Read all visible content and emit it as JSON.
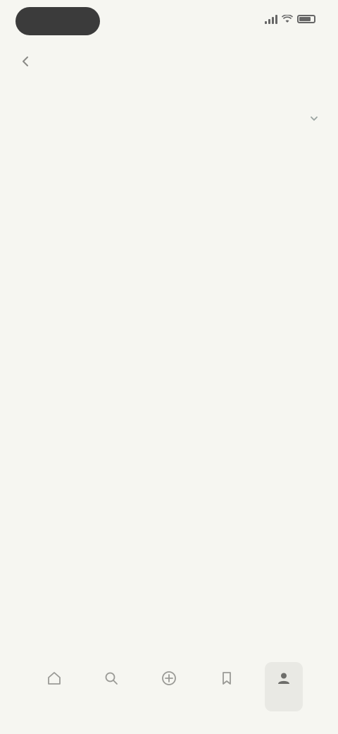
{
  "status_bar": {
    "time": "",
    "icons": [
      "signal-icon",
      "wifi-icon",
      "battery-icon"
    ]
  },
  "header": {
    "title": "",
    "back_icon": "back-arrow-icon"
  },
  "section1": {
    "title": "",
    "chevron_icon": "chevron-down-icon",
    "paragraphs": [
      "",
      ""
    ]
  },
  "section2": {
    "title": "",
    "paragraphs": [
      "",
      "",
      ""
    ],
    "link": ""
  },
  "bottom_nav": {
    "items": [
      {
        "label": "",
        "icon": "home-icon"
      },
      {
        "label": "",
        "icon": "search-icon"
      },
      {
        "label": "",
        "icon": "add-icon"
      },
      {
        "label": "",
        "icon": "bookmark-icon"
      },
      {
        "label": "",
        "icon": "profile-icon"
      }
    ],
    "active_index": 4
  },
  "colors": {
    "background": "#f6f6f1",
    "text_primary": "#4a5258",
    "text_secondary": "#8a8a86",
    "link": "#6aa68a",
    "time_pill": "#3b3b3b"
  }
}
